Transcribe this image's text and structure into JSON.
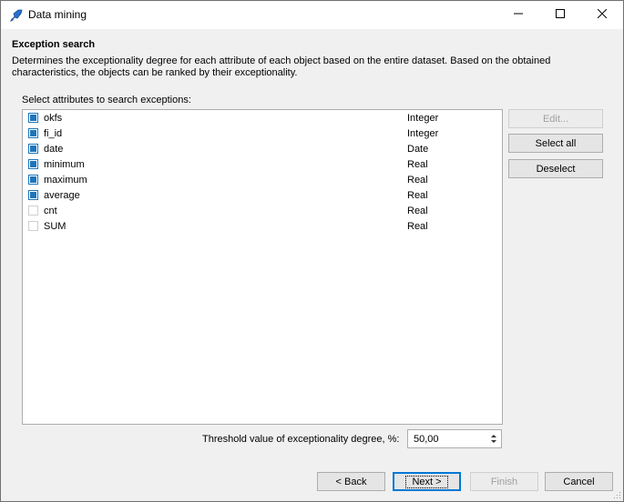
{
  "window": {
    "title": "Data mining",
    "icon": "data-mining-icon",
    "controls": [
      "minimize-icon",
      "maximize-icon",
      "close-icon"
    ]
  },
  "page": {
    "heading": "Exception search",
    "description": "Determines the exceptionality degree for each attribute of each object based on the entire dataset. Based on the obtained characteristics, the objects can be ranked by their exceptionality.",
    "list_label": "Select attributes to search exceptions:"
  },
  "attributes": [
    {
      "name": "okfs",
      "type": "Integer",
      "checked": true
    },
    {
      "name": "fi_id",
      "type": "Integer",
      "checked": true
    },
    {
      "name": "date",
      "type": "Date",
      "checked": true
    },
    {
      "name": "minimum",
      "type": "Real",
      "checked": true
    },
    {
      "name": "maximum",
      "type": "Real",
      "checked": true
    },
    {
      "name": "average",
      "type": "Real",
      "checked": true
    },
    {
      "name": "cnt",
      "type": "Real",
      "checked": false
    },
    {
      "name": "SUM",
      "type": "Real",
      "checked": false
    }
  ],
  "side_buttons": {
    "edit": "Edit...",
    "select_all": "Select all",
    "deselect": "Deselect"
  },
  "threshold": {
    "label": "Threshold value of exceptionality degree, %:",
    "value": "50,00"
  },
  "footer": {
    "back": "< Back",
    "next": "Next >",
    "finish": "Finish",
    "cancel": "Cancel"
  },
  "colors": {
    "accent": "#1e76bd",
    "dialog_bg": "#f0f0f0"
  }
}
